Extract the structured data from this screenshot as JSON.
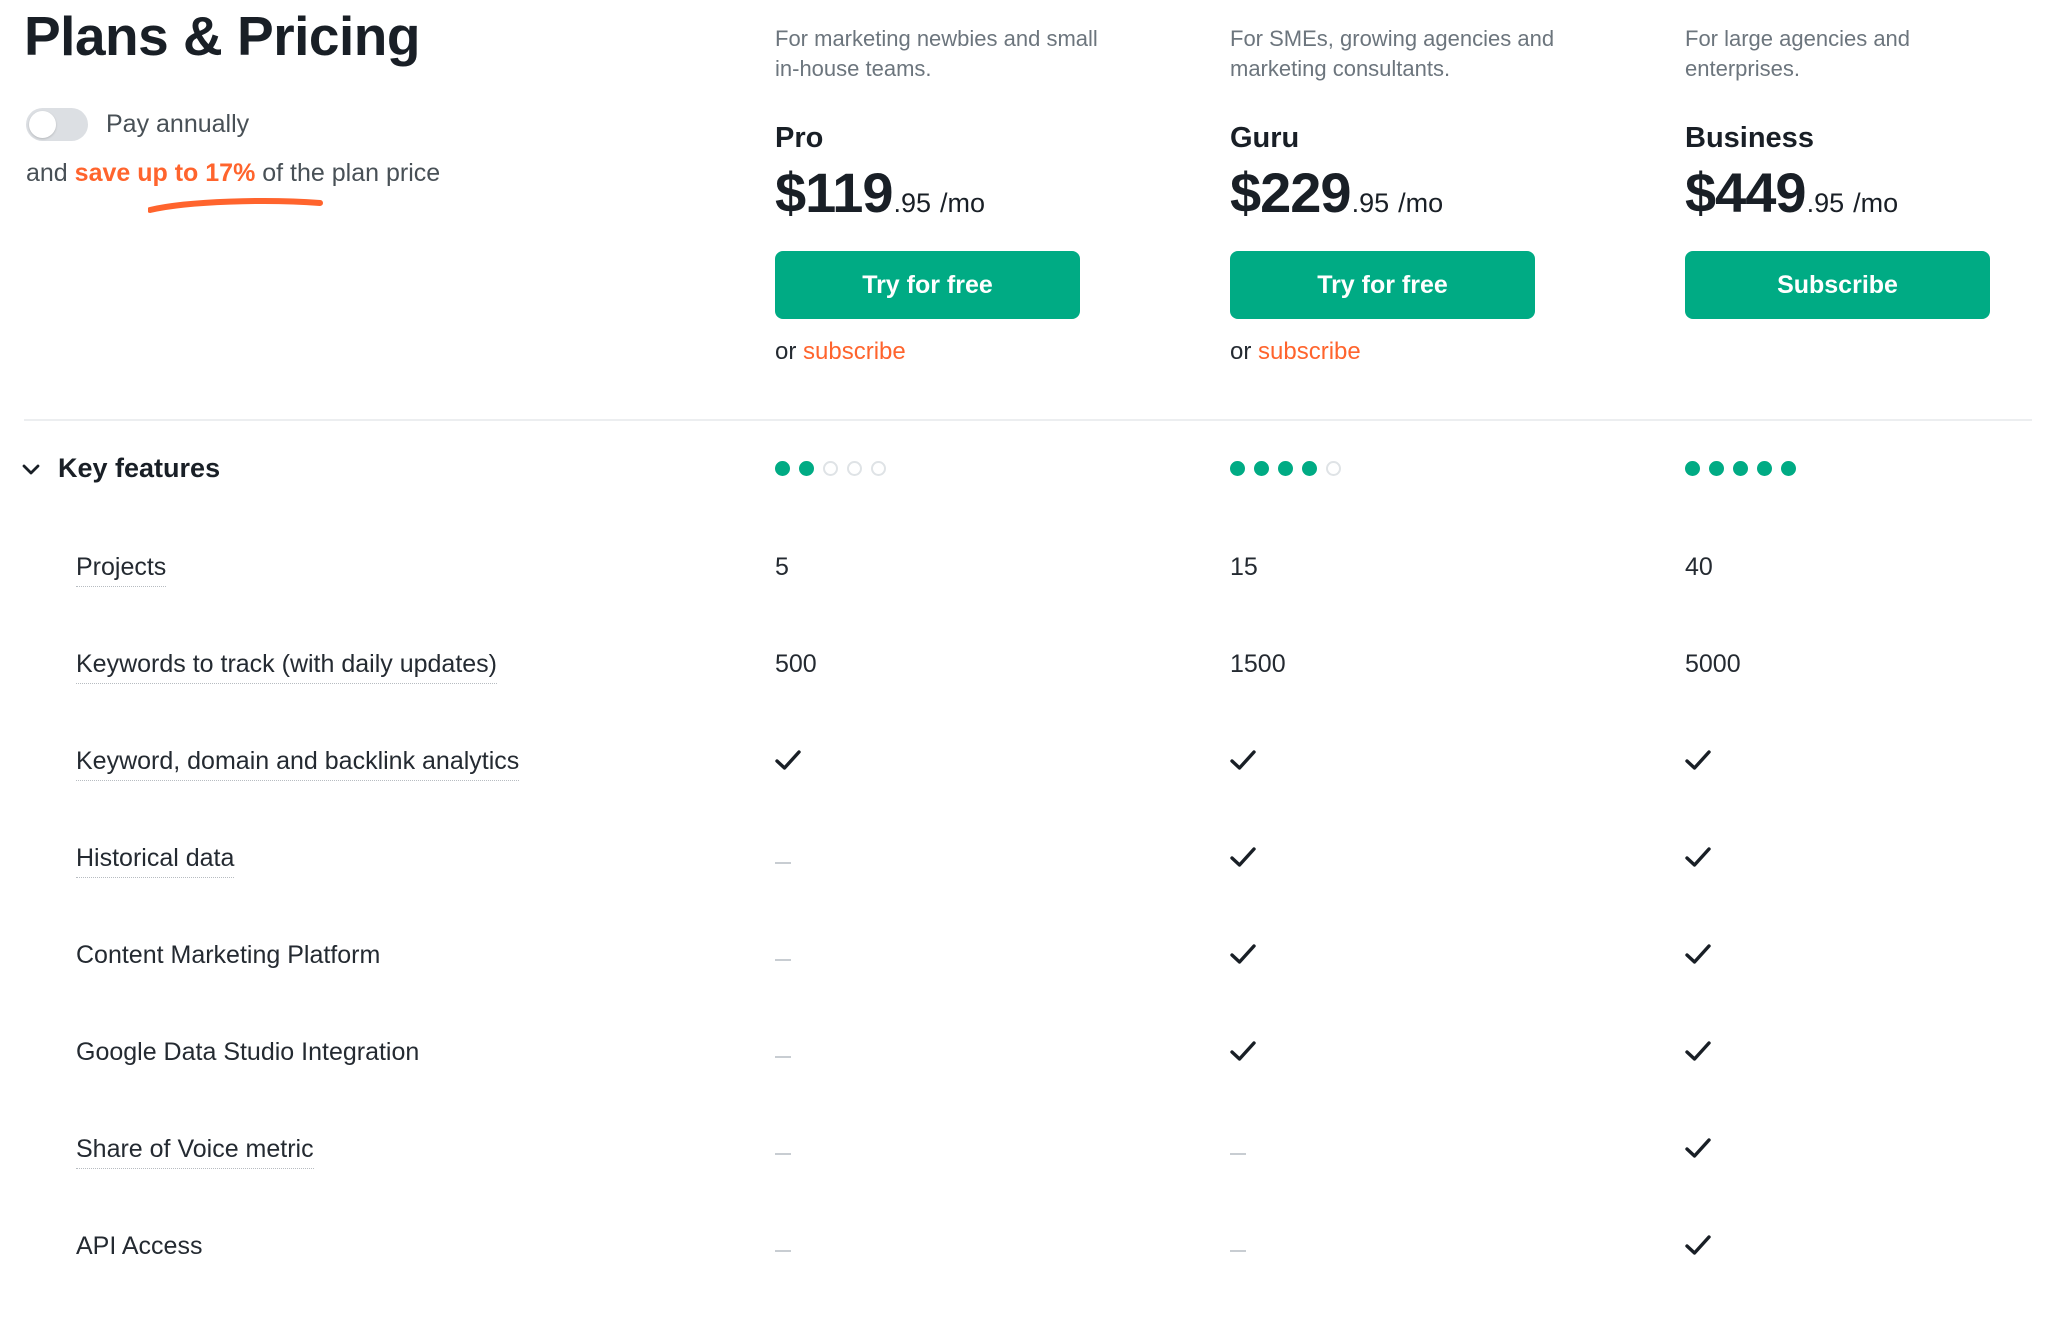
{
  "header": {
    "title": "Plans & Pricing",
    "billing": {
      "toggle_label": "Pay annually",
      "toggle_state": "off",
      "save_prefix": "and ",
      "save_highlight": "save up to 17%",
      "save_suffix": " of the plan price",
      "highlight_color": "#ff642d"
    }
  },
  "plans": [
    {
      "id": "pro",
      "description": "For marketing newbies and small in-house teams.",
      "name": "Pro",
      "price_main": "$119",
      "price_cents": ".95",
      "price_period": "/mo",
      "cta_label": "Try for free",
      "secondary_prefix": "or ",
      "secondary_link": "subscribe",
      "rating_filled": 2,
      "rating_total": 5
    },
    {
      "id": "guru",
      "description": "For SMEs, growing agencies and marketing consultants.",
      "name": "Guru",
      "price_main": "$229",
      "price_cents": ".95",
      "price_period": "/mo",
      "cta_label": "Try for free",
      "secondary_prefix": "or ",
      "secondary_link": "subscribe",
      "rating_filled": 4,
      "rating_total": 5
    },
    {
      "id": "business",
      "description": "For large agencies and enterprises.",
      "name": "Business",
      "price_main": "$449",
      "price_cents": ".95",
      "price_period": "/mo",
      "cta_label": "Subscribe",
      "secondary_prefix": "",
      "secondary_link": "",
      "rating_filled": 5,
      "rating_total": 5
    }
  ],
  "features_section": {
    "title": "Key features",
    "expanded": true,
    "chevron": "chevron-down-icon"
  },
  "features": [
    {
      "label": "Projects",
      "has_tooltip": true,
      "pro": "5",
      "guru": "15",
      "business": "40"
    },
    {
      "label": "Keywords to track (with daily updates)",
      "has_tooltip": true,
      "pro": "500",
      "guru": "1500",
      "business": "5000"
    },
    {
      "label": "Keyword, domain and backlink analytics",
      "has_tooltip": true,
      "pro": "check",
      "guru": "check",
      "business": "check"
    },
    {
      "label": "Historical data",
      "has_tooltip": true,
      "pro": "dash",
      "guru": "check",
      "business": "check"
    },
    {
      "label": "Content Marketing Platform",
      "has_tooltip": false,
      "pro": "dash",
      "guru": "check",
      "business": "check"
    },
    {
      "label": "Google Data Studio Integration",
      "has_tooltip": false,
      "pro": "dash",
      "guru": "check",
      "business": "check"
    },
    {
      "label": "Share of Voice metric",
      "has_tooltip": true,
      "pro": "dash",
      "guru": "dash",
      "business": "check"
    },
    {
      "label": "API Access",
      "has_tooltip": false,
      "pro": "dash",
      "guru": "dash",
      "business": "check"
    }
  ],
  "colors": {
    "accent_green": "#00ab84",
    "accent_orange": "#ff642d",
    "text_primary": "#242a31",
    "text_muted": "#6c757d",
    "divider": "#eceef0"
  }
}
